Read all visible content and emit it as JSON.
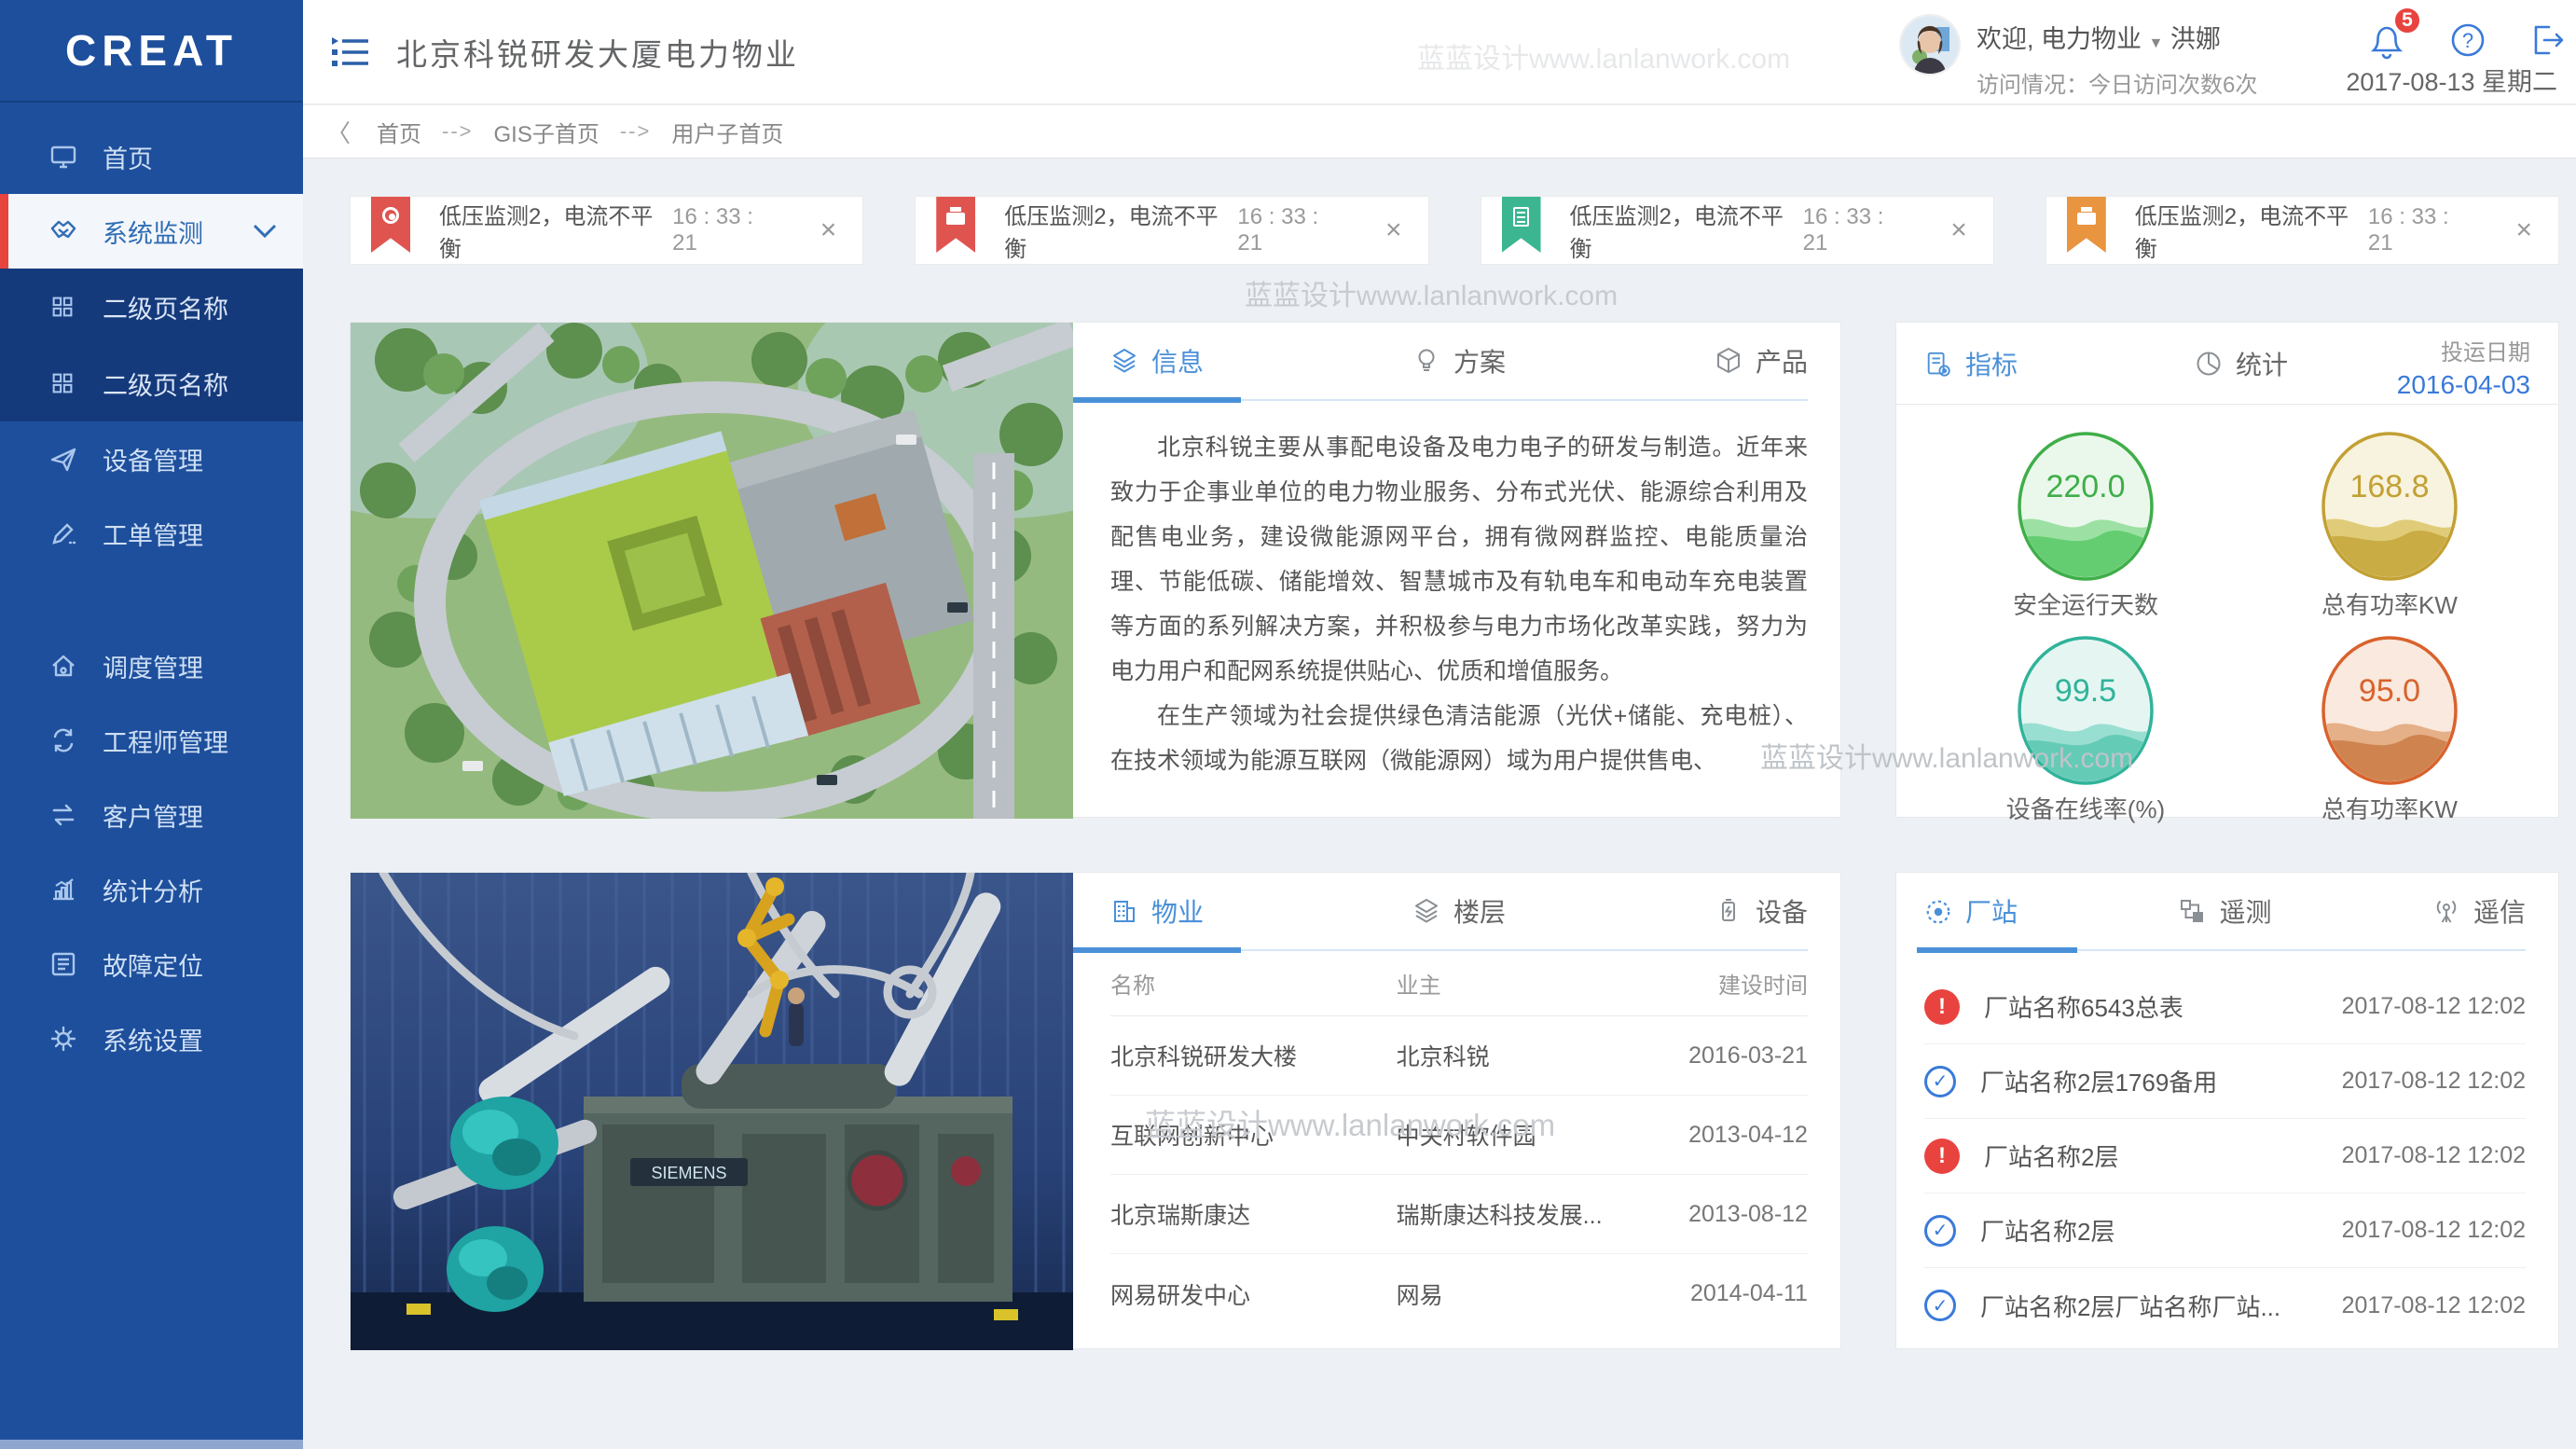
{
  "brand": {
    "logo": "CREAT"
  },
  "header": {
    "title": "北京科锐研发大厦电力物业",
    "welcome_prefix": "欢迎, 电力物业",
    "caret": "▼",
    "user_name": "洪娜",
    "visit_info": "访问情况：今日访问次数6次",
    "notification_count": "5",
    "help_glyph": "?",
    "date": "2017-08-13 星期二"
  },
  "breadcrumb": {
    "back": "〈",
    "sep": "-->",
    "items": [
      "首页",
      "GIS子首页",
      "用户子首页"
    ]
  },
  "sidebar": {
    "items": [
      {
        "icon": "monitor",
        "label": "首页"
      },
      {
        "icon": "handshake",
        "label": "系统监测"
      },
      {
        "icon": "grid",
        "label": "二级页名称"
      },
      {
        "icon": "grid",
        "label": "二级页名称"
      },
      {
        "icon": "paper-plane",
        "label": "设备管理"
      },
      {
        "icon": "pencil",
        "label": "工单管理"
      },
      {
        "icon": "house",
        "label": "调度管理"
      },
      {
        "icon": "cycle-gear",
        "label": "工程师管理"
      },
      {
        "icon": "exchange-arrows",
        "label": "客户管理"
      },
      {
        "icon": "bar-chart",
        "label": "统计分析"
      },
      {
        "icon": "document-list",
        "label": "故障定位"
      },
      {
        "icon": "gear",
        "label": "系统设置"
      }
    ]
  },
  "alerts": {
    "close": "×",
    "items": [
      {
        "icon": "fan",
        "color": "#e05450",
        "title": "低压监测2，电流不平衡",
        "time": "16 : 33 : 21"
      },
      {
        "icon": "printer",
        "color": "#e05450",
        "title": "低压监测2，电流不平衡",
        "time": "16 : 33 : 21"
      },
      {
        "icon": "calc",
        "color": "#3cb690",
        "title": "低压监测2，电流不平衡",
        "time": "16 : 33 : 21"
      },
      {
        "icon": "printer",
        "color": "#e9943f",
        "title": "低压监测2，电流不平衡",
        "time": "16 : 33 : 21"
      }
    ]
  },
  "info_card": {
    "tabs": [
      {
        "icon": "layers",
        "label": "信息"
      },
      {
        "icon": "lightbulb",
        "label": "方案"
      },
      {
        "icon": "cube",
        "label": "产品"
      }
    ],
    "paragraphs": [
      "北京科锐主要从事配电设备及电力电子的研发与制造。近年来致力于企事业单位的电力物业服务、分布式光伏、能源综合利用及配售电业务，建设微能源网平台，拥有微网群监控、电能质量治理、节能低碳、储能增效、智慧城市及有轨电车和电动车充电装置等方面的系列解决方案，并积极参与电力市场化改革实践，努力为电力用户和配网系统提供贴心、优质和增值服务。",
      "在生产领域为社会提供绿色清洁能源（光伏+储能、充电桩）、在技术领域为能源互联网（微能源网）域为用户提供售电、"
    ]
  },
  "kpi_card": {
    "tabs": [
      {
        "icon": "document-gear",
        "label": "指标"
      },
      {
        "icon": "pie-chart",
        "label": "统计"
      }
    ],
    "commission_label": "投运日期",
    "commission_date": "2016-04-03",
    "gauges": [
      {
        "value": "220.0",
        "label": "安全运行天数",
        "ring": "#3fae49",
        "fill": "#eaf8eb",
        "wave1": "#8edd96",
        "wave2": "#5fcb6b"
      },
      {
        "value": "168.8",
        "label": "总有功率KW",
        "ring": "#c2a033",
        "fill": "#f8f3de",
        "wave1": "#dcc466",
        "wave2": "#c7a93e"
      },
      {
        "value": "99.5",
        "label": "设备在线率(%)",
        "ring": "#31b39a",
        "fill": "#e5f6f2",
        "wave1": "#8cdacb",
        "wave2": "#5ec9b4"
      },
      {
        "value": "95.0",
        "label": "总有功率KW",
        "ring": "#d9622c",
        "fill": "#f9e9de",
        "wave1": "#e2a578",
        "wave2": "#cc7f4a"
      }
    ]
  },
  "property_card": {
    "tabs": [
      {
        "icon": "building",
        "label": "物业"
      },
      {
        "icon": "layers",
        "label": "楼层"
      },
      {
        "icon": "battery",
        "label": "设备"
      }
    ],
    "columns": [
      "名称",
      "业主",
      "建设时间"
    ],
    "rows": [
      {
        "name": "北京科锐研发大楼",
        "owner": "北京科锐",
        "date": "2016-03-21"
      },
      {
        "name": "互联网创新中心",
        "owner": "中关村软件园",
        "date": "2013-04-12"
      },
      {
        "name": "北京瑞斯康达",
        "owner": "瑞斯康达科技发展...",
        "date": "2013-08-12"
      },
      {
        "name": "网易研发中心",
        "owner": "网易",
        "date": "2014-04-11"
      }
    ]
  },
  "station_card": {
    "tabs": [
      {
        "icon": "gauge-dial",
        "label": "厂站"
      },
      {
        "icon": "network-nodes",
        "label": "遥测"
      },
      {
        "icon": "antenna",
        "label": "遥信"
      }
    ],
    "status_glyphs": {
      "alert": "!",
      "ok": "✓"
    },
    "rows": [
      {
        "status": "alert",
        "name": "厂站名称6543总表",
        "time": "2017-08-12 12:02"
      },
      {
        "status": "ok",
        "name": "厂站名称2层1769备用",
        "time": "2017-08-12 12:02"
      },
      {
        "status": "alert",
        "name": "厂站名称2层",
        "time": "2017-08-12 12:02"
      },
      {
        "status": "ok",
        "name": "厂站名称2层",
        "time": "2017-08-12 12:02"
      },
      {
        "status": "ok",
        "name": "厂站名称2层厂站名称厂站...",
        "time": "2017-08-12 12:02"
      }
    ]
  },
  "watermark": "蓝蓝设计www.lanlanwork.com",
  "colors": {
    "sidebar": "#1e4f9c",
    "sidebar_submenu": "#153a7c",
    "accent": "#4a90d9",
    "active_red_bar": "#e8433c",
    "alert_red": "#e8433f",
    "ok_blue": "#3a7ad9"
  }
}
